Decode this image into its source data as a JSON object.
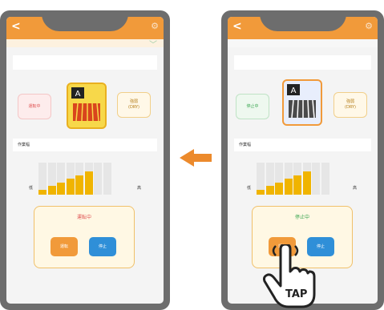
{
  "colors": {
    "accent_orange": "#f19a3a",
    "phone_frame": "#6d6d6d",
    "stop_blue": "#2f8fd8",
    "bar_yellow": "#f0b400",
    "running_red": "#e05555",
    "stopped_green": "#3aa650"
  },
  "icons": {
    "back": "<",
    "settings": "⚙",
    "collapse": "﹀"
  },
  "left_screen": {
    "status_pill": "運転中",
    "mode_pill": "強弱\n(DRY)",
    "section_title": "作業幅",
    "chart_low_label": "低",
    "chart_high_label": "高",
    "chart_level": 5,
    "chart_max": 8,
    "panel_status": "運転中",
    "run_button": "運転",
    "stop_button": "停止"
  },
  "right_screen": {
    "status_pill": "停止中",
    "mode_pill": "強弱\n(DRY)",
    "section_title": "作業幅",
    "chart_low_label": "低",
    "chart_high_label": "高",
    "chart_level": 5,
    "chart_max": 8,
    "panel_status": "停止中",
    "run_button": "運転",
    "stop_button": "停止"
  },
  "gesture": {
    "label": "TAP",
    "icon": "hand-tap-icon"
  },
  "transition": {
    "icon": "arrow-left-icon"
  }
}
